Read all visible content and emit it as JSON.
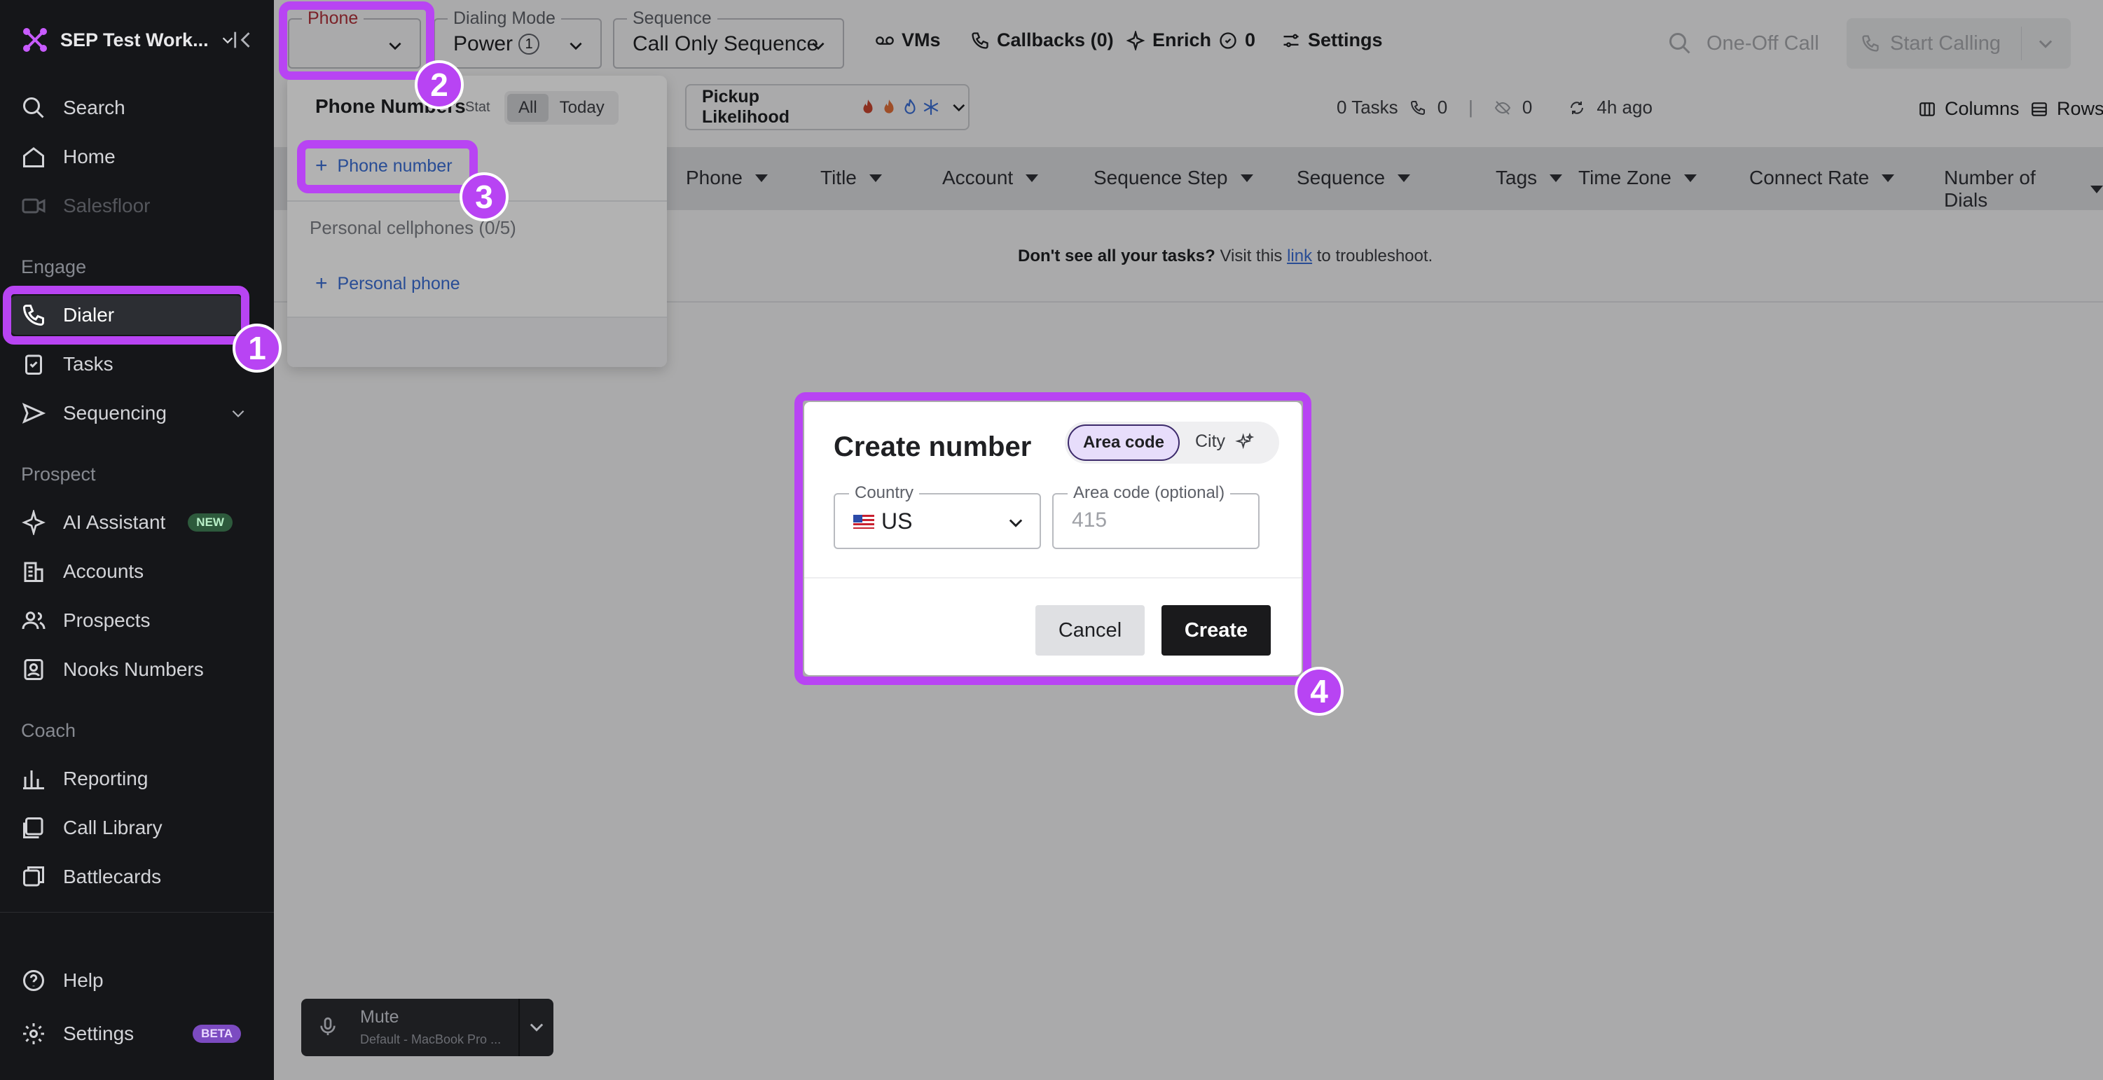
{
  "sidebar": {
    "workspace_name": "SEP Test Work...",
    "items": {
      "search": "Search",
      "home": "Home",
      "salesfloor": "Salesfloor",
      "dialer": "Dialer",
      "tasks": "Tasks",
      "sequencing": "Sequencing",
      "ai_assistant": "AI Assistant",
      "accounts": "Accounts",
      "prospects": "Prospects",
      "nooks_numbers": "Nooks Numbers",
      "reporting": "Reporting",
      "call_library": "Call Library",
      "battlecards": "Battlecards",
      "help": "Help",
      "settings": "Settings"
    },
    "sections": {
      "engage": "Engage",
      "prospect": "Prospect",
      "coach": "Coach"
    },
    "badges": {
      "new": "NEW",
      "beta": "BETA"
    }
  },
  "topbar": {
    "phone_label": "Phone",
    "phone_value": "",
    "dialing_mode_label": "Dialing Mode",
    "dialing_mode_value": "Power",
    "dialing_mode_count": "1",
    "sequence_label": "Sequence",
    "sequence_value": "Call Only Sequence",
    "vms": "VMs",
    "callbacks": "Callbacks (0)",
    "enrich": "Enrich",
    "enrich_count": "0",
    "settings": "Settings",
    "one_off_call": "One-Off Call",
    "start_calling": "Start Calling"
  },
  "toolbar": {
    "pickup_likelihood": "Pickup Likelihood",
    "tasks_count": "0 Tasks",
    "calls_count": "0",
    "sep": "|",
    "hidden_count": "0",
    "last_sync": "4h ago",
    "columns": "Columns",
    "rows": "Rows"
  },
  "table": {
    "columns": [
      "Phone",
      "Title",
      "Account",
      "Sequence Step",
      "Sequence",
      "Tags",
      "Time Zone",
      "Connect Rate",
      "Number of Dials"
    ]
  },
  "notice": {
    "bold": "Don't see all your tasks?",
    "pre": "Visit this",
    "link": "link",
    "post": "to troubleshoot."
  },
  "phone_dropdown": {
    "title": "Phone Numbers",
    "stat": "Stat",
    "filter_all": "All",
    "filter_today": "Today",
    "add_phone_number": "Phone number",
    "personal_cellphones": "Personal cellphones (0/5)",
    "add_personal_phone": "Personal phone"
  },
  "mute": {
    "label": "Mute",
    "device": "Default - MacBook Pro ..."
  },
  "modal": {
    "title": "Create number",
    "toggle_area_code": "Area code",
    "toggle_city": "City",
    "country_label": "Country",
    "country_value": "US",
    "area_code_label": "Area code (optional)",
    "area_code_placeholder": "415",
    "cancel": "Cancel",
    "create": "Create"
  },
  "steps": [
    "1",
    "2",
    "3",
    "4"
  ],
  "colors": {
    "highlight": "#b844f3",
    "sidebar_bg": "#151619",
    "accent_link": "#3b6fd6",
    "create_button": "#1a1a1c"
  }
}
